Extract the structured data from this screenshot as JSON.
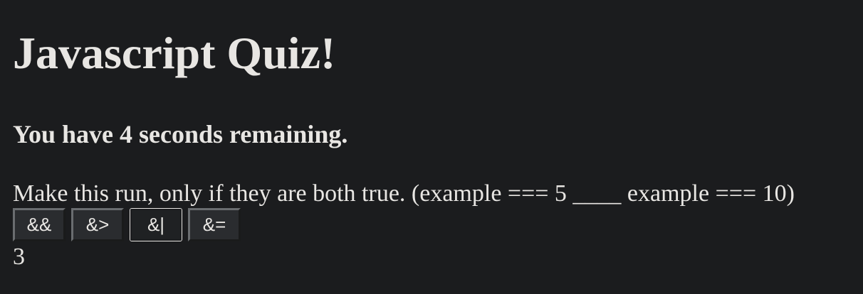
{
  "page": {
    "title": "Javascript Quiz!",
    "timer_text": "You have 4 seconds remaining."
  },
  "question": {
    "text": "Make this run, only if they are both true. (example === 5 ____ example === 10)",
    "choices": [
      {
        "label": "&&"
      },
      {
        "label": "&>"
      },
      {
        "label": "&|",
        "focused": true
      },
      {
        "label": "&="
      }
    ]
  },
  "result": {
    "value": "3"
  }
}
